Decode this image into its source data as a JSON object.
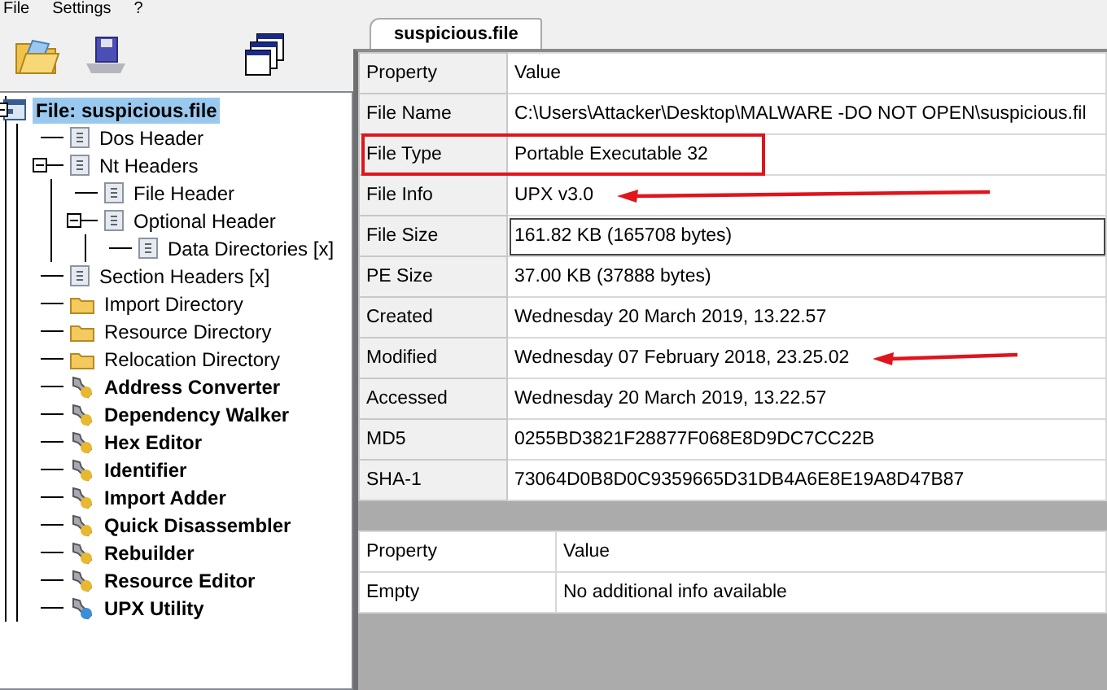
{
  "menu": [
    "File",
    "Settings",
    "?"
  ],
  "tree": [
    {
      "label": "File: suspicious.file",
      "kind": "file",
      "selected": true,
      "expanded": true,
      "children": [
        {
          "label": "Dos Header",
          "kind": "doc",
          "selected": false
        },
        {
          "label": "Nt Headers",
          "kind": "doc",
          "selected": false,
          "expanded": true,
          "children": [
            {
              "label": "File Header",
              "kind": "doc",
              "selected": false
            },
            {
              "label": "Optional Header",
              "kind": "doc",
              "selected": false,
              "expanded": true,
              "children": [
                {
                  "label": "Data Directories [x]",
                  "kind": "doc",
                  "selected": false
                }
              ]
            }
          ]
        },
        {
          "label": "Section Headers [x]",
          "kind": "doc",
          "selected": false
        },
        {
          "label": "Import Directory",
          "kind": "folder",
          "selected": false
        },
        {
          "label": "Resource Directory",
          "kind": "folder",
          "selected": false
        },
        {
          "label": "Relocation Directory",
          "kind": "folder",
          "selected": false
        },
        {
          "label": "Address Converter",
          "kind": "tool",
          "selected": false
        },
        {
          "label": "Dependency Walker",
          "kind": "tool",
          "selected": false
        },
        {
          "label": "Hex Editor",
          "kind": "tool",
          "selected": false
        },
        {
          "label": "Identifier",
          "kind": "tool",
          "selected": false
        },
        {
          "label": "Import Adder",
          "kind": "tool",
          "selected": false
        },
        {
          "label": "Quick Disassembler",
          "kind": "tool",
          "selected": false
        },
        {
          "label": "Rebuilder",
          "kind": "tool",
          "selected": false
        },
        {
          "label": "Resource Editor",
          "kind": "tool",
          "selected": false
        },
        {
          "label": "UPX Utility",
          "kind": "upx",
          "selected": false
        }
      ]
    }
  ],
  "tabs": [
    {
      "label": "suspicious.file",
      "selected": true
    }
  ],
  "properties": {
    "columns": [
      "Property",
      "Value"
    ],
    "rows": [
      {
        "property": "File Name",
        "value": "C:\\Users\\Attacker\\Desktop\\MALWARE -DO NOT OPEN\\suspicious.fil",
        "selected": false,
        "highlighted": false,
        "arrow": false
      },
      {
        "property": "File Type",
        "value": "Portable Executable 32",
        "selected": false,
        "highlighted": true,
        "arrow": false
      },
      {
        "property": "File Info",
        "value": "UPX v3.0",
        "selected": false,
        "highlighted": false,
        "arrow": true
      },
      {
        "property": "File Size",
        "value": "161.82 KB (165708 bytes)",
        "selected": true,
        "highlighted": false,
        "arrow": false
      },
      {
        "property": "PE Size",
        "value": "37.00 KB (37888 bytes)",
        "selected": false,
        "highlighted": false,
        "arrow": false
      },
      {
        "property": "Created",
        "value": "Wednesday 20 March 2019, 13.22.57",
        "selected": false,
        "highlighted": false,
        "arrow": false
      },
      {
        "property": "Modified",
        "value": "Wednesday 07 February 2018, 23.25.02",
        "selected": false,
        "highlighted": false,
        "arrow": true
      },
      {
        "property": "Accessed",
        "value": "Wednesday 20 March 2019, 13.22.57",
        "selected": false,
        "highlighted": false,
        "arrow": false
      },
      {
        "property": "MD5",
        "value": "0255BD3821F28877F068E8D9DC7CC22B",
        "selected": false,
        "highlighted": false,
        "arrow": false
      },
      {
        "property": "SHA-1",
        "value": "73064D0B8D0C9359665D31DB4A6E8E19A8D47B87",
        "selected": false,
        "highlighted": false,
        "arrow": false
      }
    ]
  },
  "details": {
    "columns": [
      "Property",
      "Value"
    ],
    "rows": [
      {
        "property": "Empty",
        "value": "No additional info available"
      }
    ]
  }
}
